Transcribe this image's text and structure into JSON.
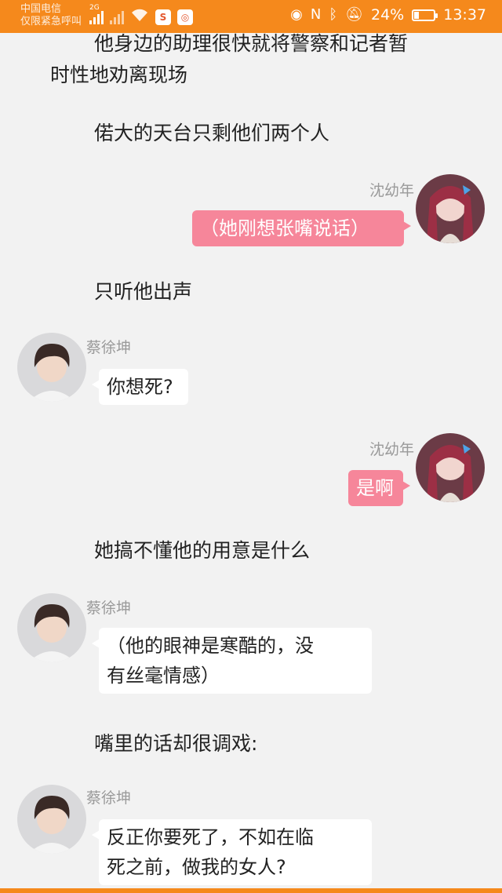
{
  "status_bar": {
    "carrier_line1": "中国电信",
    "carrier_line2": "仅限紧急呼叫",
    "network_type": "2G",
    "battery_percent": "24%",
    "battery_level": 0.24,
    "time": "13:37",
    "bg_color": "#f5891c"
  },
  "story": {
    "lines": [
      "他身边的助理很快就将警察和记者暂",
      "时性地劝离现场",
      "偌大的天台只剩他们两个人",
      "只听他出声",
      "她搞不懂他的用意是什么",
      "嘴里的话却很调戏:"
    ]
  },
  "characters": {
    "female": {
      "name": "沈幼年",
      "bubble_color": "#f6869a"
    },
    "male": {
      "name": "蔡徐坤",
      "bubble_color": "#ffffff"
    }
  },
  "messages": [
    {
      "speaker": "沈幼年",
      "text": "（她刚想张嘴说话）"
    },
    {
      "speaker": "蔡徐坤",
      "text": "你想死?"
    },
    {
      "speaker": "沈幼年",
      "text": "是啊"
    },
    {
      "speaker": "蔡徐坤",
      "line1": "（他的眼神是寒酷的，没",
      "line2": "有丝毫情感）"
    },
    {
      "speaker": "蔡徐坤",
      "line1": "反正你要死了，不如在临",
      "line2": "死之前，做我的女人?"
    }
  ]
}
